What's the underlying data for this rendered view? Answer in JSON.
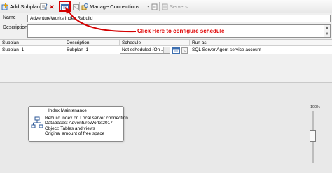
{
  "toolbar": {
    "add_subplan": "Add Subplan",
    "manage_connections": "Manage Connections ...",
    "servers": "Servers ..."
  },
  "properties": {
    "name_label": "Name",
    "name_value": "AdventureWorks Index Rebuild",
    "description_label": "Description",
    "description_value": ""
  },
  "callout": {
    "text": "Click Here to configure schedule",
    "color": "#e00000"
  },
  "grid": {
    "headers": [
      "Subplan",
      "Description",
      "Schedule",
      "Run as"
    ],
    "row": {
      "subplan": "Subplan_1",
      "description": "Subplan_1",
      "schedule": "Not scheduled (On ...",
      "run_as": "SQL Server Agent service account"
    }
  },
  "task": {
    "title": "Index Maintenance",
    "lines": [
      "Rebuild index on Local server connection",
      "Databases: AdventureWorks2017",
      "Object: Tables and views",
      "Original amount of free space"
    ]
  },
  "zoom": {
    "label": "100%",
    "level_fraction": 0.5
  }
}
